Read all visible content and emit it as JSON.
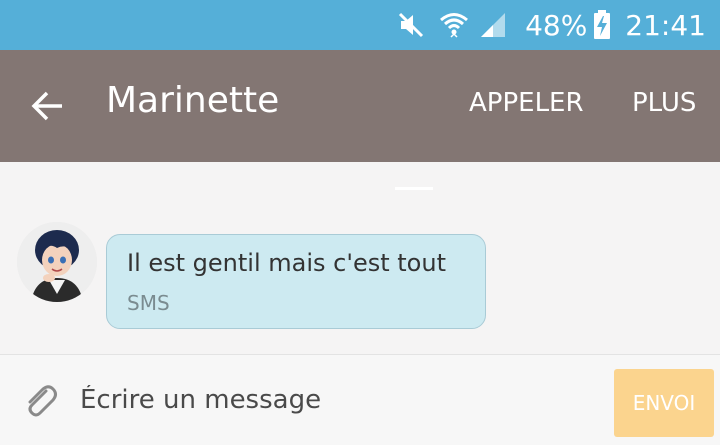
{
  "status_bar": {
    "battery_percent": "48%",
    "time": "21:41",
    "icons": [
      "mute-icon",
      "wifi-icon",
      "signal-icon",
      "battery-charging-icon"
    ],
    "color": "#55afd8"
  },
  "header": {
    "back_icon": "arrow-left-icon",
    "title": "Marinette",
    "actions": {
      "call_label": "APPELER",
      "more_label": "PLUS"
    },
    "color": "#837673"
  },
  "conversation": {
    "messages": [
      {
        "sender_avatar": "avatar",
        "text": "Il est gentil mais c'est tout",
        "type": "SMS",
        "bubble_color": "#cdeaf1"
      }
    ]
  },
  "composer": {
    "attach_icon": "paperclip-icon",
    "placeholder": "Écrire un message",
    "value": "",
    "send_label": "ENVOI",
    "send_color": "#fbd48e"
  }
}
